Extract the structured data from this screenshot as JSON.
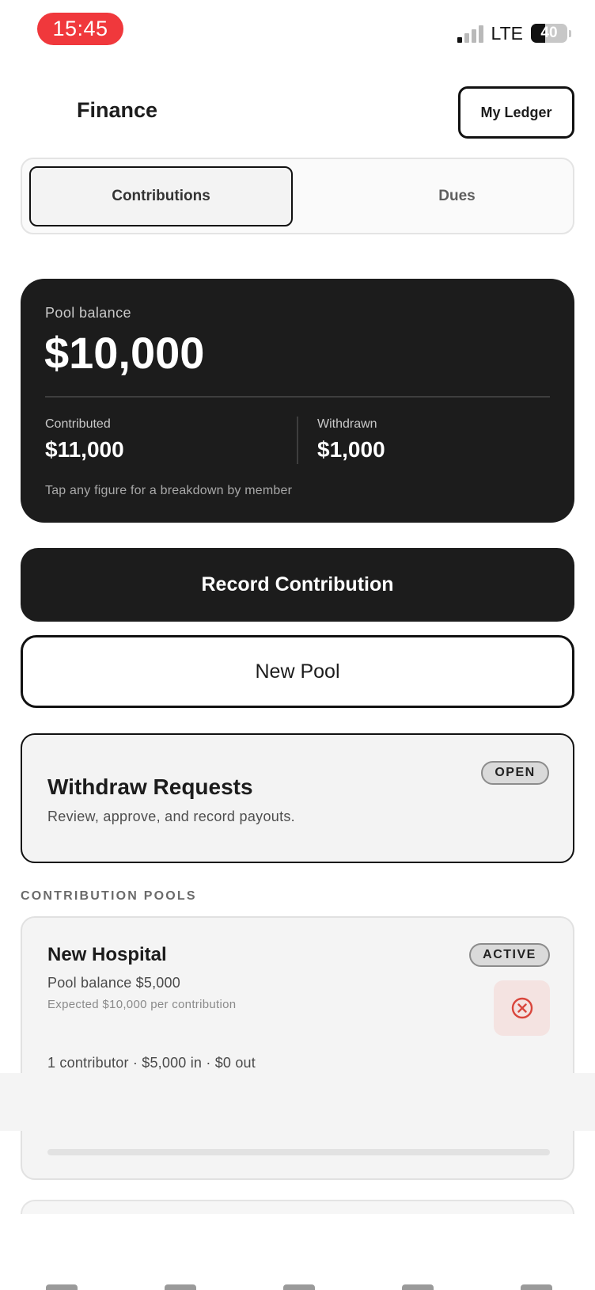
{
  "status_bar": {
    "time": "15:45",
    "network": "LTE",
    "battery_percent": "40",
    "battery_level": 0.4,
    "signal_bars_active": 1
  },
  "header": {
    "title": "Finance",
    "ledger_button": "My Ledger"
  },
  "tabs": [
    {
      "label": "Contributions",
      "active": true
    },
    {
      "label": "Dues",
      "active": false
    }
  ],
  "balance_card": {
    "label": "Pool balance",
    "amount": "$10,000",
    "contributed_label": "Contributed",
    "contributed_value": "$11,000",
    "withdrawn_label": "Withdrawn",
    "withdrawn_value": "$1,000",
    "hint": "Tap any figure for a breakdown by member"
  },
  "actions": {
    "record_contribution": "Record Contribution",
    "new_pool": "New Pool"
  },
  "withdraw_requests": {
    "title": "Withdraw Requests",
    "subtitle": "Review, approve, and record payouts.",
    "badge": "OPEN"
  },
  "pools_section": {
    "label": "CONTRIBUTION POOLS",
    "pools": [
      {
        "name": "New Hospital",
        "status": "ACTIVE",
        "balance": "Pool balance $5,000",
        "expected": "Expected $10,000 per contribution",
        "stats": "1 contributor · $5,000 in · $0 out",
        "progress": 0.0
      }
    ]
  },
  "colors": {
    "accent_dark": "#1c1c1c",
    "status_time_bg": "#f0383c",
    "delete_bg": "#f4e3e1",
    "delete_icon": "#d9463c"
  },
  "icons": {
    "pool_delete": "close-circle-icon",
    "signal": "cellular-signal-icon",
    "battery": "battery-icon"
  }
}
